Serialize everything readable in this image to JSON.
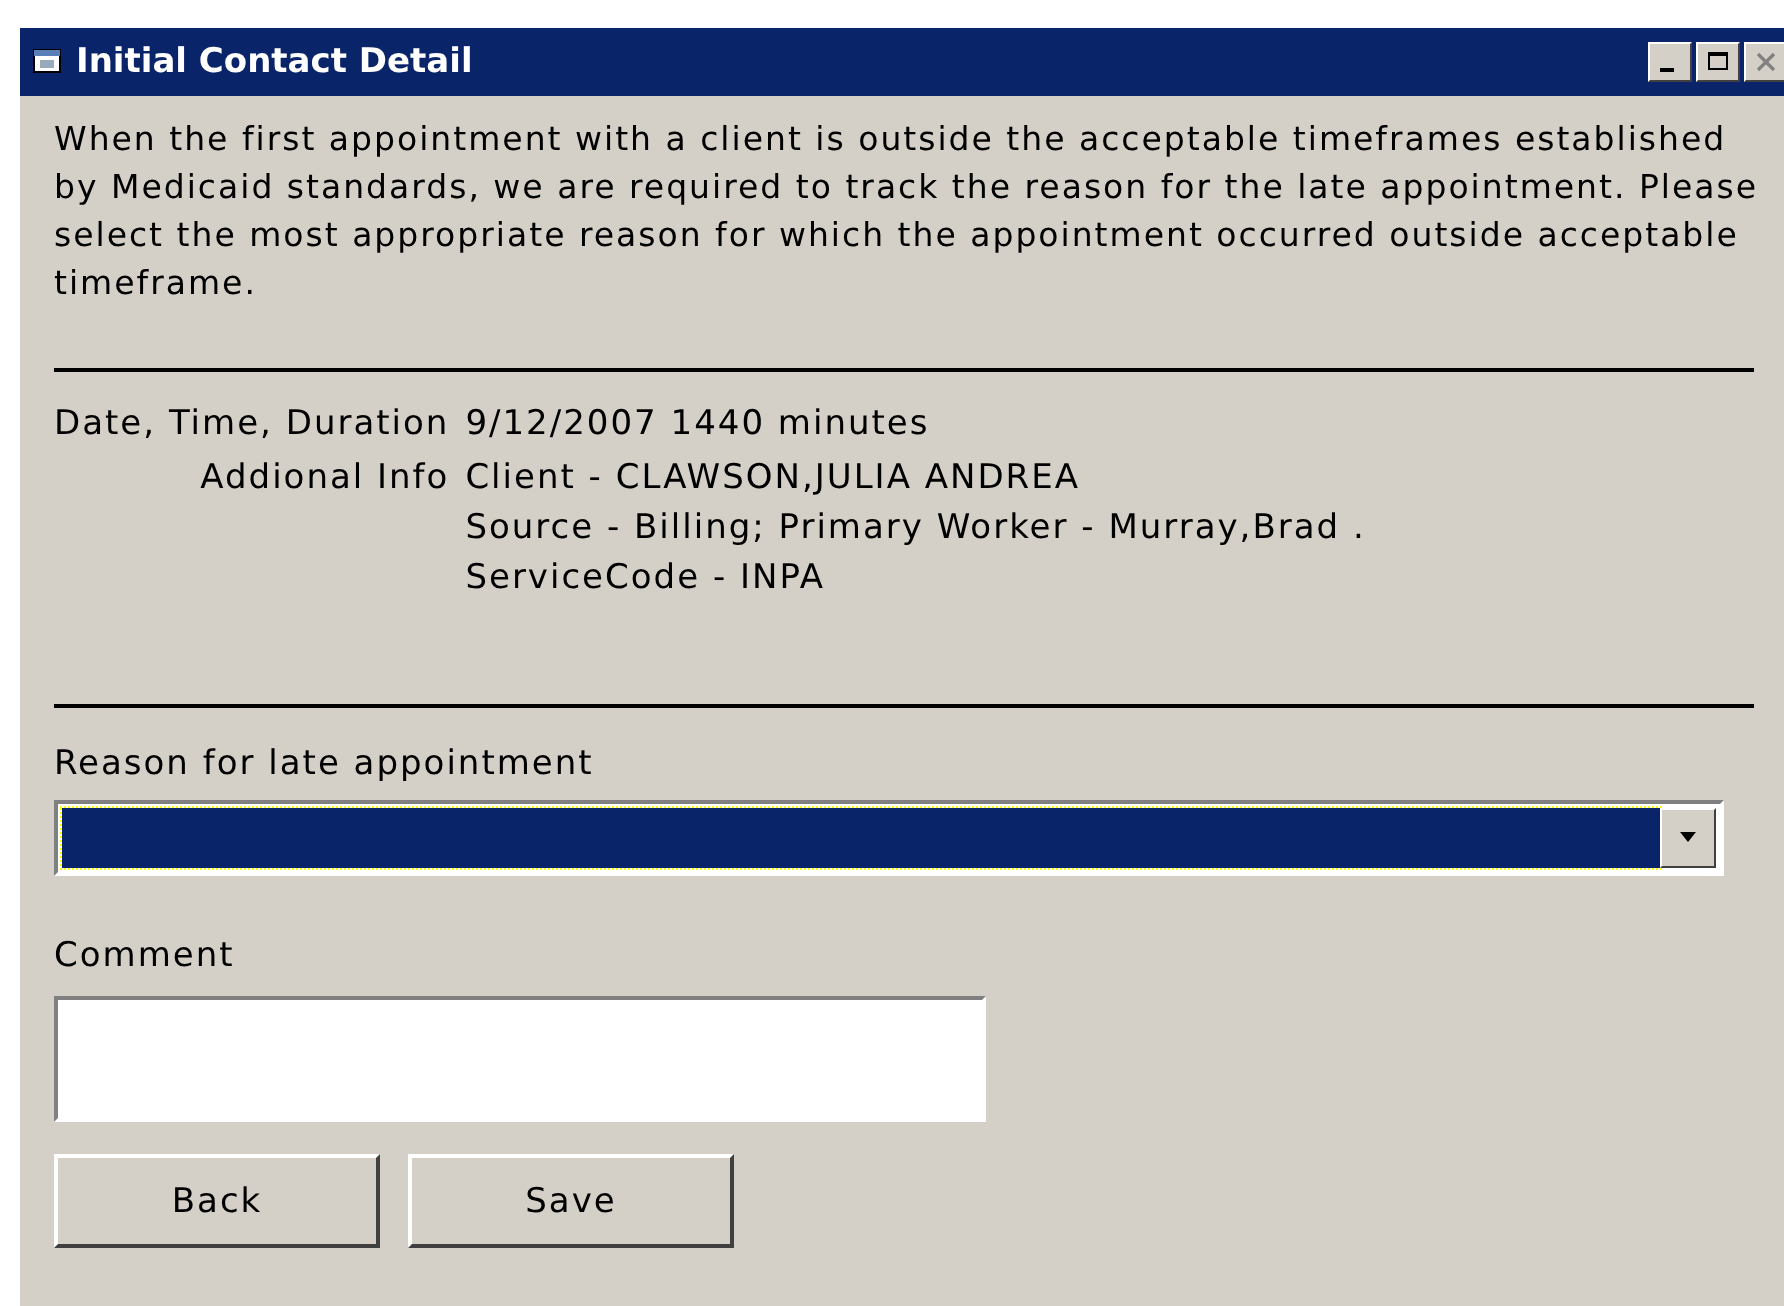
{
  "window": {
    "title": "Initial Contact Detail"
  },
  "intro": "When the first appointment with a client is outside the acceptable timeframes established by Medicaid standards, we are required to track the reason for the late appointment. Please select the most appropriate reason for which the appointment occurred outside acceptable timeframe.",
  "details": [
    {
      "label": "Date, Time, Duration",
      "lines": [
        "9/12/2007 1440 minutes"
      ]
    },
    {
      "label": "Addional Info",
      "lines": [
        "Client - CLAWSON,JULIA ANDREA",
        "Source - Billing; Primary Worker - Murray,Brad .",
        "ServiceCode - INPA"
      ]
    }
  ],
  "reason": {
    "label": "Reason for late appointment"
  },
  "comment": {
    "label": "Comment"
  },
  "buttons": [
    "Back",
    "Save"
  ]
}
